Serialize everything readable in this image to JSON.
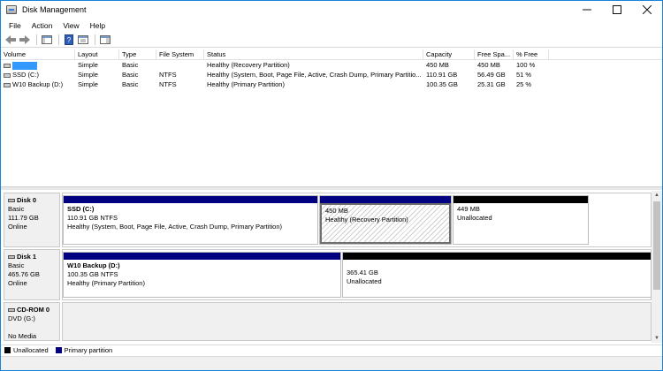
{
  "window": {
    "title": "Disk Management"
  },
  "menu": [
    "File",
    "Action",
    "View",
    "Help"
  ],
  "columns": [
    "Volume",
    "Layout",
    "Type",
    "File System",
    "Status",
    "Capacity",
    "Free Spa...",
    "% Free"
  ],
  "volumes": [
    {
      "volume": "",
      "layout": "Simple",
      "type": "Basic",
      "fs": "",
      "status": "Healthy (Recovery Partition)",
      "capacity": "450 MB",
      "free": "450 MB",
      "pct": "100 %"
    },
    {
      "volume": "SSD (C:)",
      "layout": "Simple",
      "type": "Basic",
      "fs": "NTFS",
      "status": "Healthy (System, Boot, Page File, Active, Crash Dump, Primary Partitio...",
      "capacity": "110.91 GB",
      "free": "56.49 GB",
      "pct": "51 %"
    },
    {
      "volume": "W10 Backup (D:)",
      "layout": "Simple",
      "type": "Basic",
      "fs": "NTFS",
      "status": "Healthy (Primary Partition)",
      "capacity": "100.35 GB",
      "free": "25.31 GB",
      "pct": "25 %"
    }
  ],
  "disks": [
    {
      "name": "Disk 0",
      "type": "Basic",
      "size": "111.79 GB",
      "state": "Online",
      "partitions": [
        {
          "title": "SSD  (C:)",
          "line1": "110.91 GB NTFS",
          "line2": "Healthy (System, Boot, Page File, Active, Crash Dump, Primary Partition)"
        },
        {
          "title": "",
          "line1": "450 MB",
          "line2": "Healthy (Recovery Partition)"
        },
        {
          "title": "",
          "line1": "449 MB",
          "line2": "Unallocated"
        }
      ]
    },
    {
      "name": "Disk 1",
      "type": "Basic",
      "size": "465.76 GB",
      "state": "Online",
      "partitions": [
        {
          "title": "W10 Backup  (D:)",
          "line1": "100.35 GB NTFS",
          "line2": "Healthy (Primary Partition)"
        },
        {
          "title": "",
          "line1": "365.41 GB",
          "line2": "Unallocated"
        }
      ]
    },
    {
      "name": "CD-ROM 0",
      "type": "DVD (G:)",
      "size": "",
      "state": "No Media"
    }
  ],
  "legend": {
    "unallocated": "Unallocated",
    "primary": "Primary partition"
  },
  "colors": {
    "primary": "#000080",
    "unallocated": "#000000",
    "selection": "#3399ff"
  }
}
